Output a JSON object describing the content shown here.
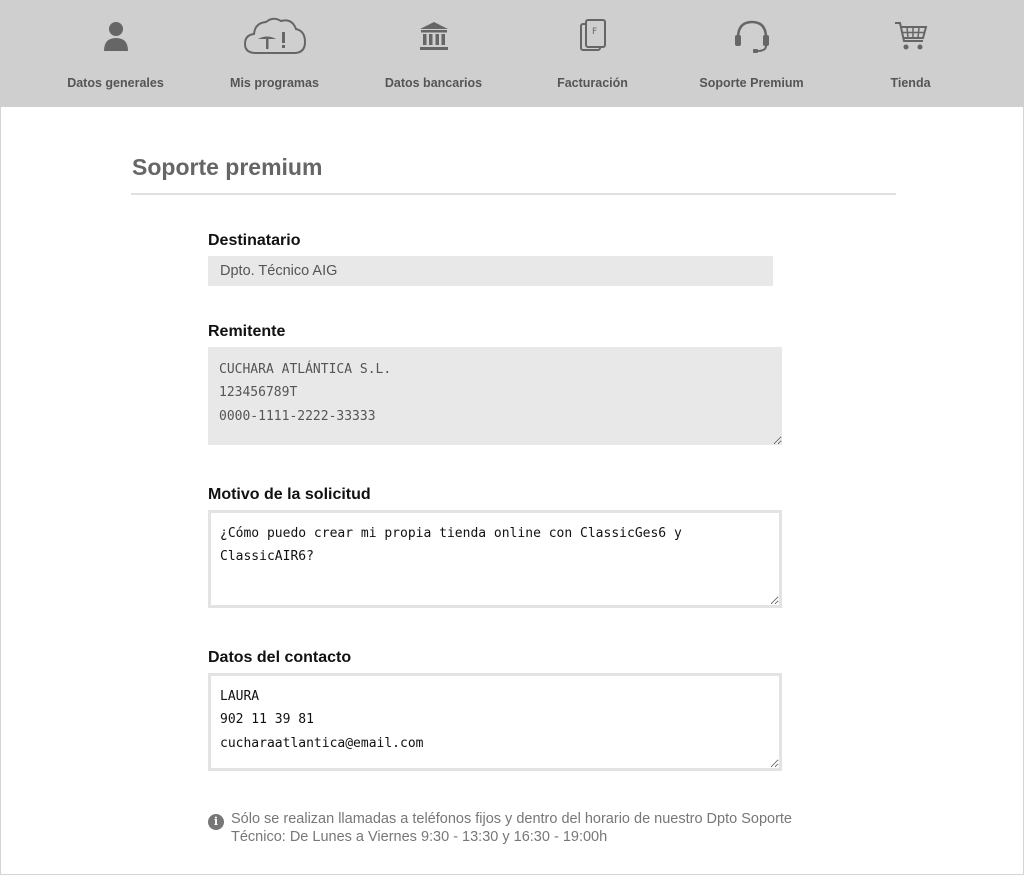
{
  "nav": {
    "items": [
      {
        "label": "Datos generales",
        "icon": "user-icon"
      },
      {
        "label": "Mis programas",
        "icon": "cloud-icon"
      },
      {
        "label": "Datos bancarios",
        "icon": "bank-icon"
      },
      {
        "label": "Facturación",
        "icon": "invoice-icon"
      },
      {
        "label": "Soporte Premium",
        "icon": "headset-icon"
      },
      {
        "label": "Tienda",
        "icon": "cart-icon"
      }
    ]
  },
  "page": {
    "title": "Soporte premium"
  },
  "form": {
    "recipient": {
      "label": "Destinatario",
      "value": "Dpto. Técnico AIG"
    },
    "sender": {
      "label": "Remitente",
      "value": "CUCHARA ATLÁNTICA S.L.\n123456789T\n0000-1111-2222-33333"
    },
    "reason": {
      "label": "Motivo de la solicitud",
      "value": "¿Cómo puedo crear mi propia tienda online con ClassicGes6 y ClassicAIR6?"
    },
    "contact": {
      "label": "Datos del contacto",
      "value": "LAURA\n902 11 39 81\ncucharaatlantica@email.com"
    }
  },
  "notice": {
    "icon": "info-icon",
    "text": "Sólo se realizan llamadas a teléfonos fijos y dentro del horario de nuestro Dpto Soporte Técnico: De Lunes a Viernes 9:30 - 13:30 y 16:30 - 19:00h"
  },
  "colors": {
    "nav_bg": "#cfcfcf",
    "icon": "#666666",
    "input_bg": "#e8e8e8"
  }
}
